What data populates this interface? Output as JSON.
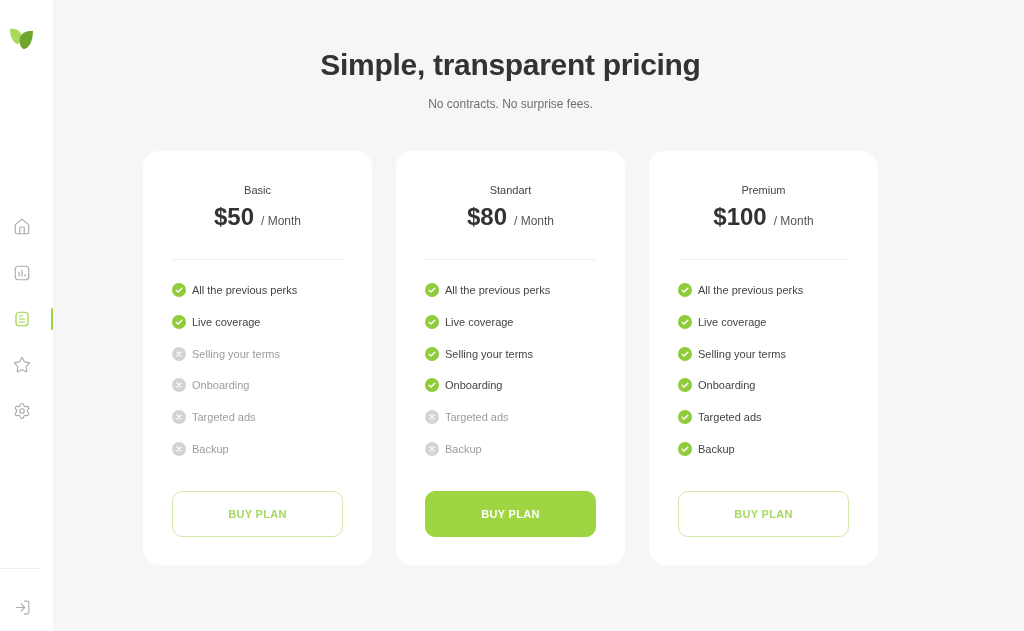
{
  "sidebar": {
    "nav_items": [
      {
        "selected": false
      },
      {
        "selected": false
      },
      {
        "selected": true
      },
      {
        "selected": false
      },
      {
        "selected": false
      }
    ]
  },
  "header": {
    "title": "Simple, transparent pricing",
    "subtitle": "No contracts. No surprise fees."
  },
  "plans": [
    {
      "name": "Basic",
      "price": "$50",
      "period": "/ Month",
      "features": [
        {
          "label": "All the previous perks",
          "included": true
        },
        {
          "label": "Live coverage",
          "included": true
        },
        {
          "label": "Selling your terms",
          "included": false
        },
        {
          "label": "Onboarding",
          "included": false
        },
        {
          "label": "Targeted ads",
          "included": false
        },
        {
          "label": "Backup",
          "included": false
        }
      ],
      "button": {
        "label": "BUY PLAN",
        "highlighted": false
      }
    },
    {
      "name": "Standart",
      "price": "$80",
      "period": "/ Month",
      "features": [
        {
          "label": "All the previous perks",
          "included": true
        },
        {
          "label": "Live coverage",
          "included": true
        },
        {
          "label": "Selling your terms",
          "included": true
        },
        {
          "label": "Onboarding",
          "included": true
        },
        {
          "label": "Targeted ads",
          "included": false
        },
        {
          "label": "Backup",
          "included": false
        }
      ],
      "button": {
        "label": "BUY PLAN",
        "highlighted": true
      }
    },
    {
      "name": "Premium",
      "price": "$100",
      "period": "/ Month",
      "features": [
        {
          "label": "All the previous perks",
          "included": true
        },
        {
          "label": "Live coverage",
          "included": true
        },
        {
          "label": "Selling your terms",
          "included": true
        },
        {
          "label": "Onboarding",
          "included": true
        },
        {
          "label": "Targeted ads",
          "included": true
        },
        {
          "label": "Backup",
          "included": true
        }
      ],
      "button": {
        "label": "BUY PLAN",
        "highlighted": false
      }
    }
  ]
}
